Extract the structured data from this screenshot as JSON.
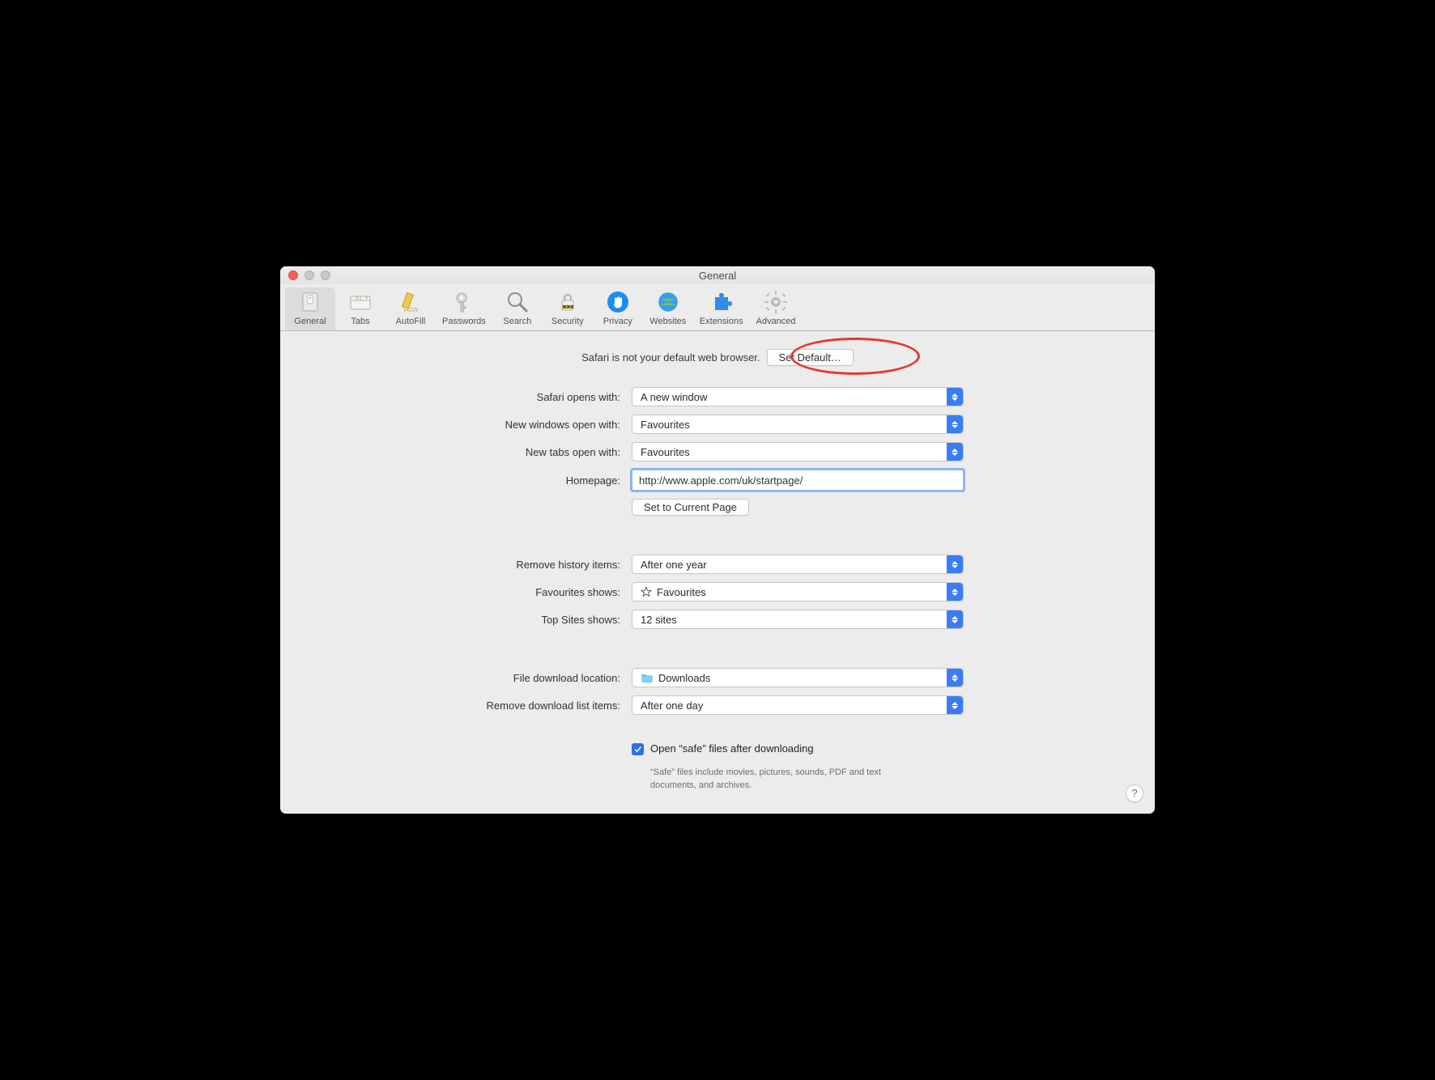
{
  "window": {
    "title": "General"
  },
  "toolbar": {
    "items": [
      {
        "id": "general",
        "label": "General",
        "selected": true
      },
      {
        "id": "tabs",
        "label": "Tabs",
        "selected": false
      },
      {
        "id": "autofill",
        "label": "AutoFill",
        "selected": false
      },
      {
        "id": "passwords",
        "label": "Passwords",
        "selected": false
      },
      {
        "id": "search",
        "label": "Search",
        "selected": false
      },
      {
        "id": "security",
        "label": "Security",
        "selected": false
      },
      {
        "id": "privacy",
        "label": "Privacy",
        "selected": false
      },
      {
        "id": "websites",
        "label": "Websites",
        "selected": false
      },
      {
        "id": "extensions",
        "label": "Extensions",
        "selected": false
      },
      {
        "id": "advanced",
        "label": "Advanced",
        "selected": false
      }
    ]
  },
  "banner": {
    "text": "Safari is not your default web browser.",
    "button": "Set Default…"
  },
  "labels": {
    "opens_with": "Safari opens with:",
    "new_windows": "New windows open with:",
    "new_tabs": "New tabs open with:",
    "homepage": "Homepage:",
    "set_current": "Set to Current Page",
    "remove_history": "Remove history items:",
    "favourites_shows": "Favourites shows:",
    "top_sites_shows": "Top Sites shows:",
    "download_location": "File download location:",
    "remove_download_list": "Remove download list items:",
    "open_safe": "Open “safe” files after downloading",
    "safe_note": "“Safe” files include movies, pictures, sounds, PDF and text documents, and archives."
  },
  "values": {
    "opens_with": "A new window",
    "new_windows": "Favourites",
    "new_tabs": "Favourites",
    "homepage": "http://www.apple.com/uk/startpage/",
    "remove_history": "After one year",
    "favourites_shows": "Favourites",
    "top_sites_shows": "12 sites",
    "download_location": "Downloads",
    "remove_download_list": "After one day",
    "open_safe_checked": true
  },
  "help": "?"
}
